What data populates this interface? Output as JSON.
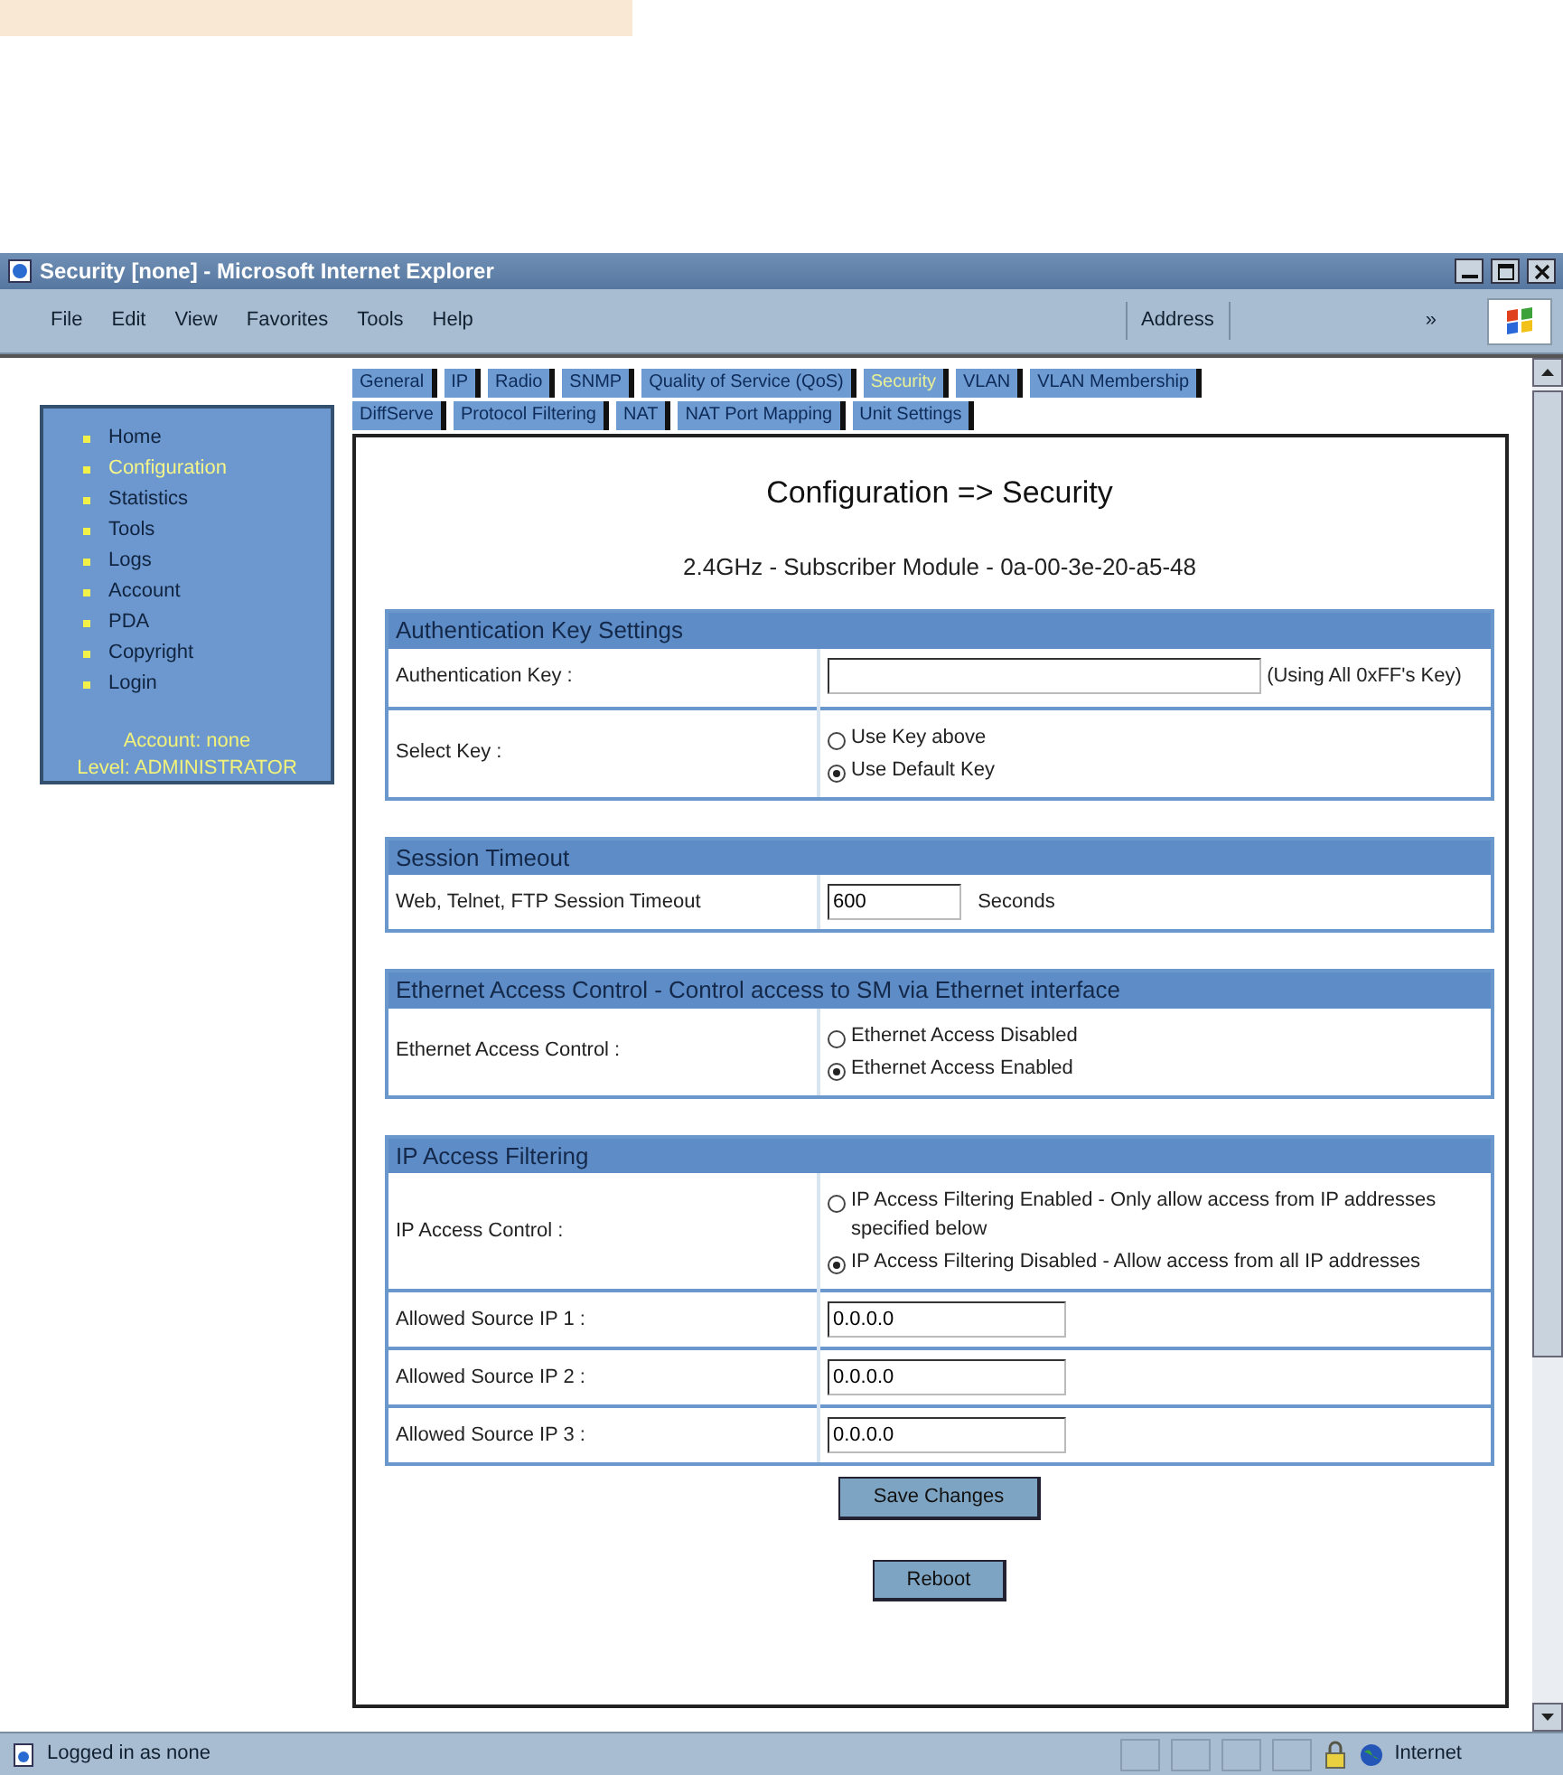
{
  "window": {
    "title": "Security [none] - Microsoft Internet Explorer"
  },
  "menu": [
    "File",
    "Edit",
    "View",
    "Favorites",
    "Tools",
    "Help"
  ],
  "toolbar": {
    "address_label": "Address",
    "chevron": "»"
  },
  "sidebar": {
    "items": [
      {
        "label": "Home",
        "selected": false
      },
      {
        "label": "Configuration",
        "selected": true
      },
      {
        "label": "Statistics",
        "selected": false
      },
      {
        "label": "Tools",
        "selected": false
      },
      {
        "label": "Logs",
        "selected": false
      },
      {
        "label": "Account",
        "selected": false
      },
      {
        "label": "PDA",
        "selected": false
      },
      {
        "label": "Copyright",
        "selected": false
      },
      {
        "label": "Login",
        "selected": false
      }
    ],
    "account": "Account: none",
    "level": "Level: ADMINISTRATOR"
  },
  "tab_rows": [
    [
      {
        "label": "General",
        "selected": false
      },
      {
        "label": "IP",
        "selected": false
      },
      {
        "label": "Radio",
        "selected": false
      },
      {
        "label": "SNMP",
        "selected": false
      },
      {
        "label": "Quality of Service (QoS)",
        "selected": false
      },
      {
        "label": "Security",
        "selected": true
      },
      {
        "label": "VLAN",
        "selected": false
      },
      {
        "label": "VLAN Membership",
        "selected": false
      }
    ],
    [
      {
        "label": "DiffServe",
        "selected": false
      },
      {
        "label": "Protocol Filtering",
        "selected": false
      },
      {
        "label": "NAT",
        "selected": false
      },
      {
        "label": "NAT Port Mapping",
        "selected": false
      },
      {
        "label": "Unit Settings",
        "selected": false
      }
    ]
  ],
  "page": {
    "title": "Configuration => Security",
    "subtitle": "2.4GHz - Subscriber Module - 0a-00-3e-20-a5-48"
  },
  "sections": [
    {
      "title": "Authentication Key Settings",
      "rows": [
        {
          "kind": "wide_input",
          "label": "Authentication Key :",
          "note": "(Using All 0xFF's Key)"
        },
        {
          "kind": "radio",
          "label": "Select Key :",
          "options": [
            {
              "label": "Use Key above",
              "selected": false
            },
            {
              "label": "Use Default Key",
              "selected": true
            }
          ]
        }
      ]
    },
    {
      "title": "Session Timeout",
      "rows": [
        {
          "kind": "short_input",
          "label": "Web, Telnet, FTP Session Timeout",
          "value": "600",
          "note": "Seconds"
        }
      ]
    },
    {
      "title": "Ethernet Access Control - Control access to SM via Ethernet interface",
      "rows": [
        {
          "kind": "radio",
          "label": "Ethernet Access Control :",
          "options": [
            {
              "label": "Ethernet Access Disabled",
              "selected": false
            },
            {
              "label": "Ethernet Access Enabled",
              "selected": true
            }
          ]
        }
      ]
    },
    {
      "title": "IP Access Filtering",
      "rows": [
        {
          "kind": "radio",
          "label": "IP Access Control :",
          "options": [
            {
              "label": "IP Access Filtering Enabled - Only allow access from IP addresses specified below",
              "selected": false
            },
            {
              "label": "IP Access Filtering Disabled - Allow access from all IP addresses",
              "selected": true
            }
          ]
        },
        {
          "kind": "input",
          "label": "Allowed Source IP 1 :",
          "value": "0.0.0.0"
        },
        {
          "kind": "input",
          "label": "Allowed Source IP 2 :",
          "value": "0.0.0.0"
        },
        {
          "kind": "input",
          "label": "Allowed Source IP 3 :",
          "value": "0.0.0.0"
        }
      ]
    }
  ],
  "buttons": [
    "Save Changes",
    "Reboot"
  ],
  "status_bar": {
    "text": "Logged in as none",
    "zone": "Internet"
  }
}
